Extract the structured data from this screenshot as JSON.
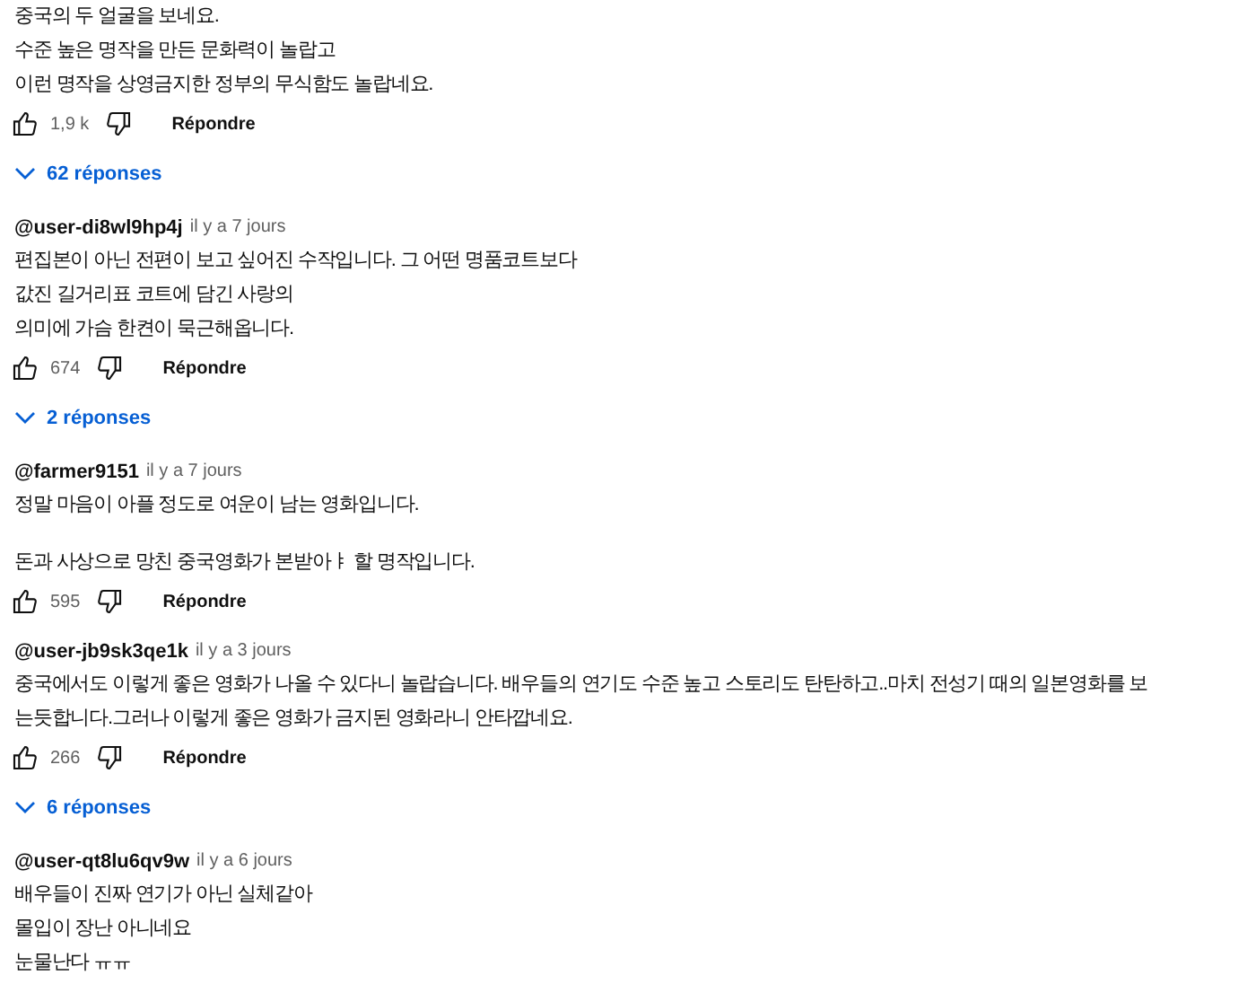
{
  "comments": [
    {
      "paragraphs": [
        [
          "중국의 두 얼굴을 보네요.",
          "수준 높은 명작을 만든 문화력이 놀랍고",
          "이런 명작을 상영금지한 정부의 무식함도 놀랍네요."
        ]
      ],
      "likes": "1,9 k",
      "reply_button": "Répondre",
      "replies": "62 réponses"
    },
    {
      "author": "@user-di8wl9hp4j",
      "time": "il y a 7 jours",
      "paragraphs": [
        [
          "편집본이 아닌 전편이 보고 싶어진 수작입니다. 그 어떤 명품코트보다",
          "값진 길거리표 코트에 담긴 사랑의",
          "의미에 가슴 한켠이 묵근해옵니다."
        ]
      ],
      "likes": "674",
      "reply_button": "Répondre",
      "replies": "2 réponses"
    },
    {
      "author": "@farmer9151",
      "time": "il y a 7 jours",
      "paragraphs": [
        [
          "정말 마음이 아플 정도로 여운이 남는 영화입니다."
        ],
        [
          "돈과 사상으로 망친 중국영화가 본받아ㅑ 할 명작입니다."
        ]
      ],
      "likes": "595",
      "reply_button": "Répondre"
    },
    {
      "author": "@user-jb9sk3qe1k",
      "time": "il y a 3 jours",
      "paragraphs": [
        [
          "중국에서도 이렇게 좋은 영화가 나올 수 있다니 놀랍습니다. 배우들의 연기도 수준 높고 스토리도 탄탄하고..마치 전성기 때의 일본영화를 보",
          "는듯합니다.그러나 이렇게 좋은 영화가 금지된 영화라니 안타깝네요."
        ]
      ],
      "likes": "266",
      "reply_button": "Répondre",
      "replies": "6 réponses"
    },
    {
      "author": "@user-qt8lu6qv9w",
      "time": "il y a 6 jours",
      "paragraphs": [
        [
          "배우들이 진짜 연기가 아닌 실체같아",
          "몰입이 장난 아니네요",
          "눈물난다 ㅠㅠ"
        ]
      ]
    }
  ]
}
